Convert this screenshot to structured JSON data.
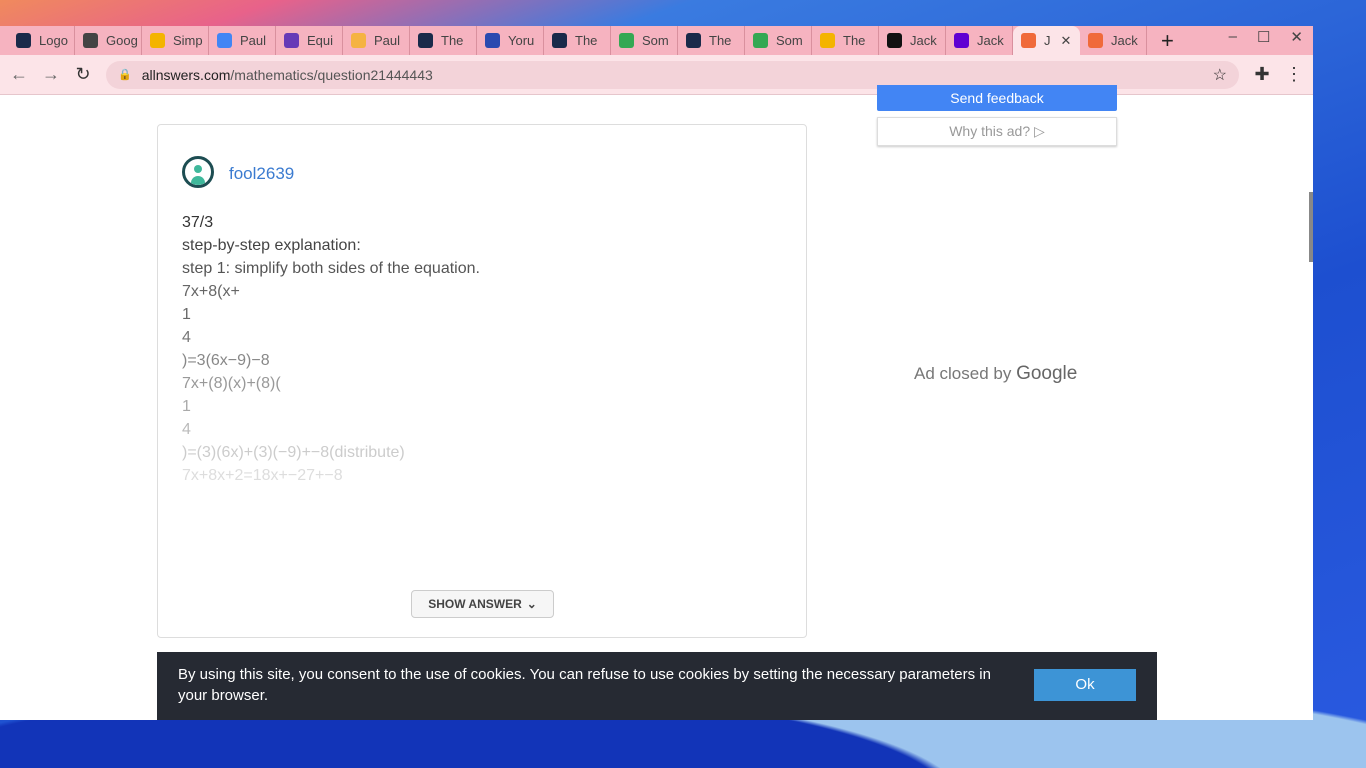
{
  "tabs": [
    {
      "label": "Logo",
      "color": "#1a2a4a"
    },
    {
      "label": "Goog",
      "color": "#444"
    },
    {
      "label": "Simp",
      "color": "#f4b400"
    },
    {
      "label": "Paul",
      "color": "#4285f4"
    },
    {
      "label": "Equi",
      "color": "#673ab7"
    },
    {
      "label": "Paul",
      "color": "#f5b342"
    },
    {
      "label": "The",
      "color": "#1a2a4a"
    },
    {
      "label": "Yoru",
      "color": "#2a4ab0"
    },
    {
      "label": "The",
      "color": "#1a2a4a"
    },
    {
      "label": "Som",
      "color": "#34a853"
    },
    {
      "label": "The",
      "color": "#1a2a4a"
    },
    {
      "label": "Som",
      "color": "#34a853"
    },
    {
      "label": "The",
      "color": "#f4b400"
    },
    {
      "label": "Jack",
      "color": "#111"
    },
    {
      "label": "Jack",
      "color": "#6001d2"
    },
    {
      "label": "J",
      "color": "#f06a3a",
      "active": true
    },
    {
      "label": "Jack",
      "color": "#f06a3a"
    }
  ],
  "url": {
    "host": "allnswers.com",
    "path": "/mathematics/question21444443"
  },
  "answer": {
    "username": "fool2639",
    "lines": [
      "37/3",
      "step-by-step explanation:",
      "step 1: simplify both sides of the equation.",
      "7x+8(x+",
      "1",
      "4",
      ")=3(6x−9)−8",
      "7x+(8)(x)+(8)(",
      "1",
      "4",
      ")=(3)(6x)+(3)(−9)+−8(distribute)",
      "7x+8x+2=18x+−27+−8"
    ],
    "show_answer": "SHOW ANSWER"
  },
  "ad": {
    "send_feedback": "Send feedback",
    "why": "Why this ad? ▷",
    "closed": "Ad closed by",
    "google": "Google"
  },
  "cookie": {
    "text": "By using this site, you consent to the use of cookies. You can refuse to use cookies by setting the necessary parameters in your browser.",
    "ok": "Ok"
  }
}
